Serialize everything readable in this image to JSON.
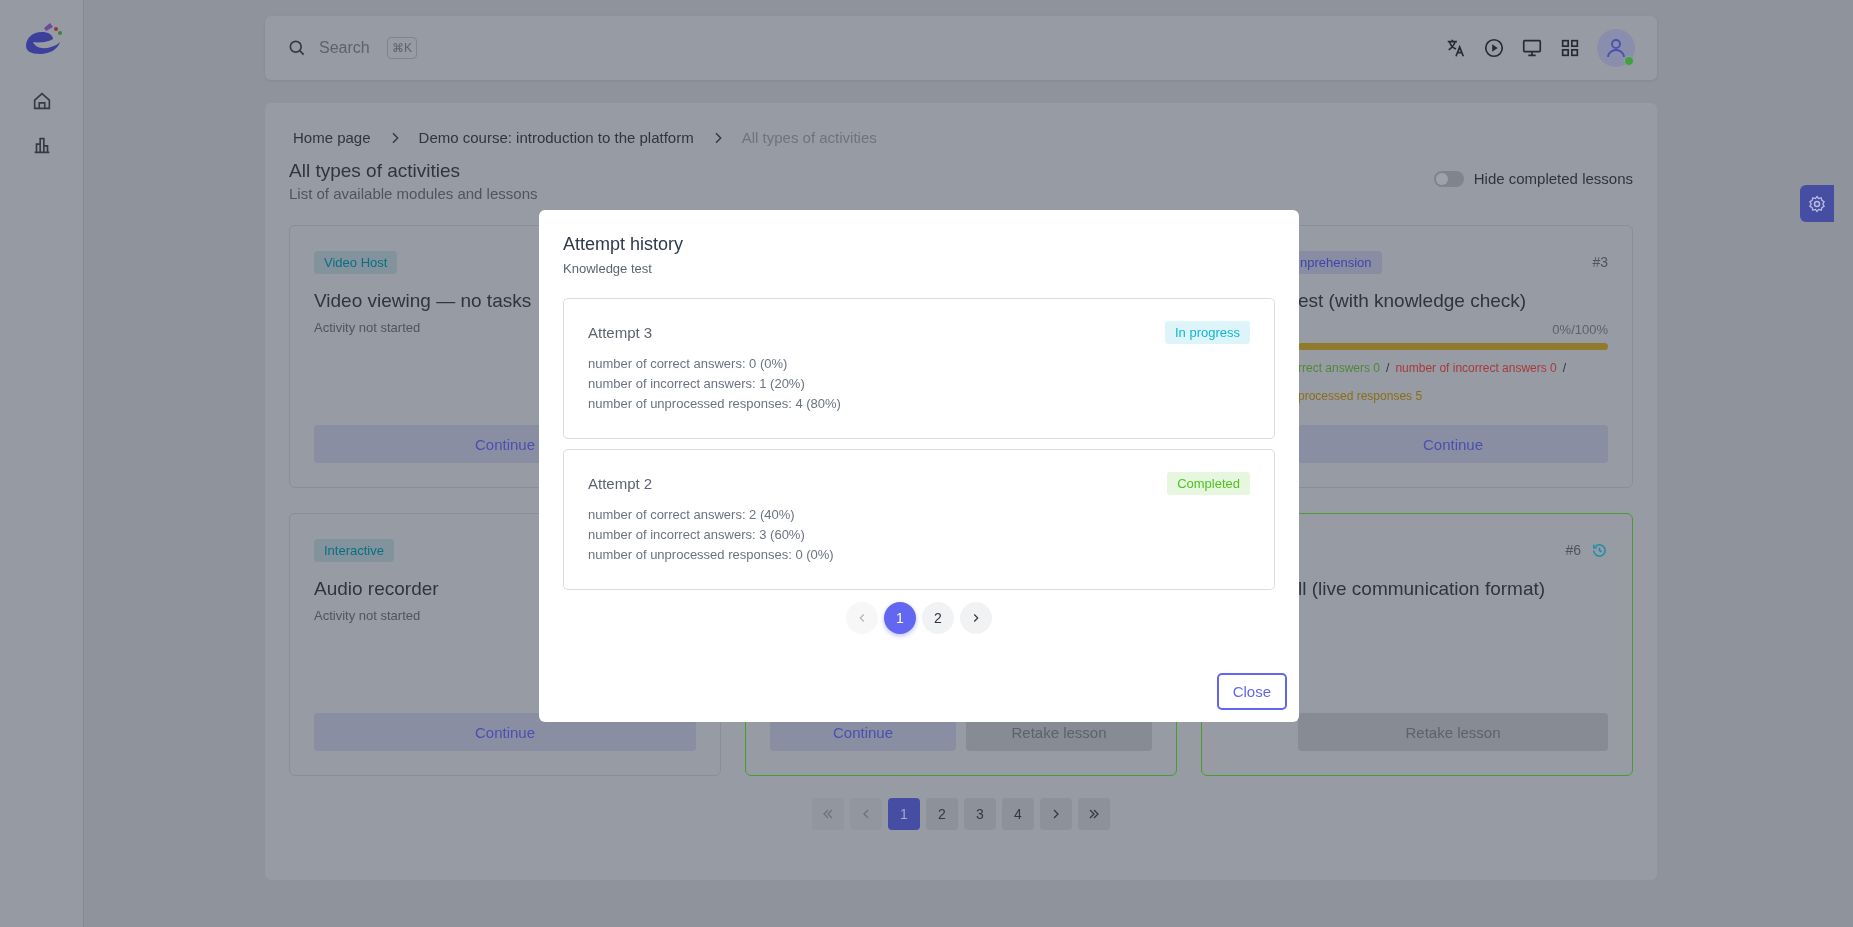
{
  "search": {
    "placeholder": "Search",
    "shortcut": "⌘K"
  },
  "user": {
    "online": true
  },
  "breadcrumbs": [
    {
      "label": "Home page",
      "current": false
    },
    {
      "label": "Demo course: introduction to the platform",
      "current": false
    },
    {
      "label": "All types of activities",
      "current": true
    }
  ],
  "page": {
    "title": "All types of activities",
    "subtitle": "List of available modules and lessons"
  },
  "hide_completed": {
    "label": "Hide completed lessons",
    "on": false
  },
  "activities": [
    {
      "badge": {
        "label": "Video Host",
        "color": "#0c6e80"
      },
      "title": "Video viewing — no tasks",
      "status": "Activity not started",
      "completed": false,
      "buttons": [
        {
          "label": "Continue",
          "kind": "continue"
        }
      ]
    },
    {
      "badge": {
        "label": "nprehension",
        "color": "#3f44a8"
      },
      "number": "#3",
      "title": "est (with knowledge check)",
      "progress": {
        "label": "0%/100%",
        "level": 0
      },
      "stats": {
        "separator": "/",
        "items": [
          {
            "text": "rrect answers 0",
            "kind": "correct"
          },
          {
            "text": "number of incorrect answers 0",
            "kind": "incorrect"
          },
          {
            "text": "processed responses 5",
            "kind": "unprocessed"
          }
        ]
      },
      "completed": false,
      "buttons": [
        {
          "label": "Continue",
          "kind": "continue"
        }
      ]
    },
    {
      "badge": {
        "label": "Interactive",
        "color": "#0c6e80"
      },
      "title": "Audio recorder",
      "status": "Activity not started",
      "completed": false,
      "buttons": [
        {
          "label": "Continue",
          "kind": "continue"
        }
      ]
    },
    {
      "completed": true,
      "buttons": [
        {
          "label": "Continue",
          "kind": "continue"
        },
        {
          "label": "Retake lesson",
          "kind": "retake"
        }
      ]
    },
    {
      "number": "#6",
      "history": true,
      "title": "ll (live communication format)",
      "completed": true,
      "buttons": [
        {
          "label": "Retake lesson",
          "kind": "retake"
        }
      ]
    }
  ],
  "pager": {
    "first": {
      "disabled": true
    },
    "prev": {
      "disabled": true
    },
    "next": {
      "disabled": false
    },
    "last": {
      "disabled": false
    },
    "pages": [
      {
        "label": "1",
        "selected": true
      },
      {
        "label": "2",
        "selected": false
      },
      {
        "label": "3",
        "selected": false
      },
      {
        "label": "4",
        "selected": false
      }
    ]
  },
  "modal": {
    "title": "Attempt history",
    "subtitle": "Knowledge test",
    "attempts": [
      {
        "title": "Attempt 3",
        "status": "In progress",
        "color": "#11b5d6",
        "lines": [
          "number of correct answers: 0 (0%)",
          "number of incorrect answers: 1 (20%)",
          "number of unprocessed responses: 4 (80%)"
        ]
      },
      {
        "title": "Attempt 2",
        "status": "Completed",
        "color": "#4fc21f",
        "lines": [
          "number of correct answers: 2 (40%)",
          "number of incorrect answers: 3 (60%)",
          "number of unprocessed responses: 0 (0%)"
        ]
      }
    ],
    "pager": {
      "prev": {
        "disabled": true
      },
      "next": {
        "disabled": false
      },
      "pages": [
        {
          "label": "1",
          "selected": true
        },
        {
          "label": "2",
          "selected": false
        }
      ]
    },
    "close": "Close"
  }
}
